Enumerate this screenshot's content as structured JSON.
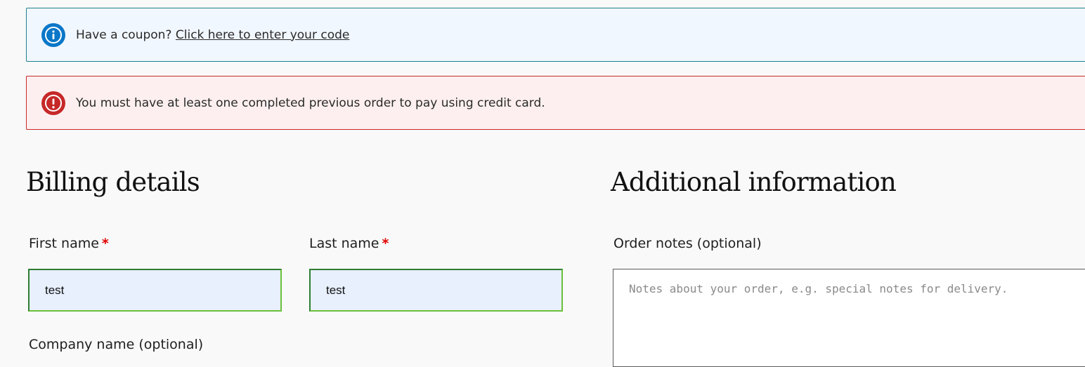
{
  "notices": {
    "coupon": {
      "text": "Have a coupon?",
      "link": "Click here to enter your code",
      "icon": "info-icon",
      "color": "#0a77c8"
    },
    "error": {
      "text": "You must have at least one completed previous order to pay using credit card.",
      "icon": "error-icon",
      "color": "#c62828"
    }
  },
  "billing": {
    "heading": "Billing details",
    "first_name": {
      "label": "First name",
      "required_mark": "*",
      "value": "test"
    },
    "last_name": {
      "label": "Last name",
      "required_mark": "*",
      "value": "test"
    },
    "company": {
      "label": "Company name (optional)"
    }
  },
  "additional": {
    "heading": "Additional information",
    "order_notes": {
      "label": "Order notes (optional)",
      "placeholder": "Notes about your order, e.g. special notes for delivery."
    }
  }
}
